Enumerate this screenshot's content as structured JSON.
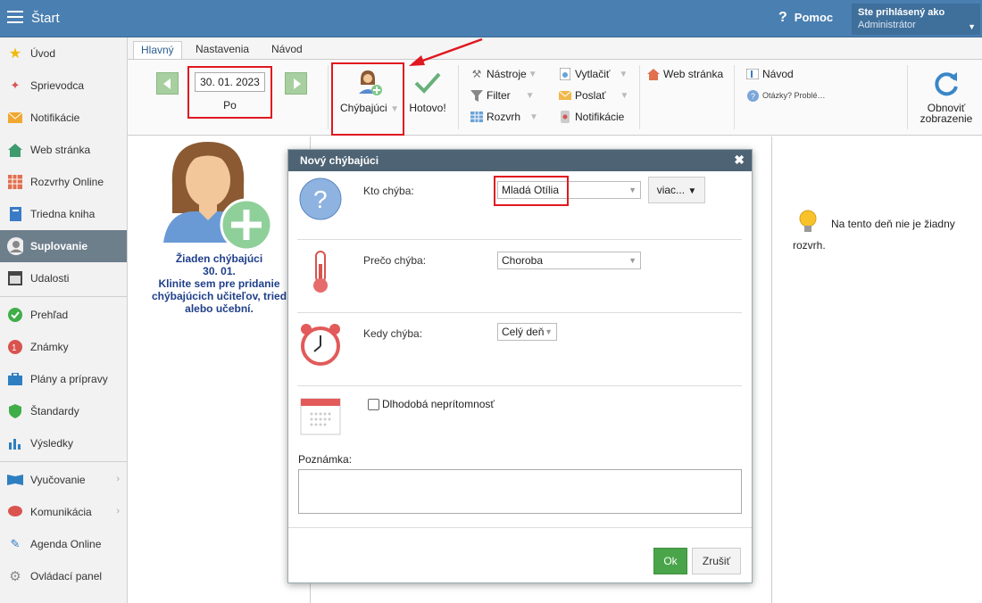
{
  "topbar": {
    "title": "Štart",
    "help_label": "Pomoc",
    "user_line1": "Ste prihlásený ako",
    "user_line2": "Administrátor"
  },
  "sidebar": {
    "items": [
      {
        "label": "Úvod",
        "icon": "star-icon"
      },
      {
        "label": "Sprievodca",
        "icon": "wand-icon"
      },
      {
        "label": "Notifikácie",
        "icon": "envelope-icon"
      },
      {
        "label": "Web stránka",
        "icon": "house-icon"
      },
      {
        "label": "Rozvrhy Online",
        "icon": "grid-icon"
      },
      {
        "label": "Triedna kniha",
        "icon": "book-icon"
      },
      {
        "label": "Suplovanie",
        "icon": "person-icon"
      },
      {
        "label": "Udalosti",
        "icon": "calendar-icon"
      },
      {
        "label": "Prehľad",
        "icon": "check-circle-icon"
      },
      {
        "label": "Známky",
        "icon": "grade-icon"
      },
      {
        "label": "Plány a prípravy",
        "icon": "briefcase-icon"
      },
      {
        "label": "Štandardy",
        "icon": "shield-icon"
      },
      {
        "label": "Výsledky",
        "icon": "bar-chart-icon"
      },
      {
        "label": "Vyučovanie",
        "icon": "open-book-icon"
      },
      {
        "label": "Komunikácia",
        "icon": "chat-icon"
      },
      {
        "label": "Agenda Online",
        "icon": "pen-icon"
      },
      {
        "label": "Ovládací panel",
        "icon": "gear-icon"
      }
    ]
  },
  "tabs": [
    "Hlavný",
    "Nastavenia",
    "Návod"
  ],
  "ribbon": {
    "date": "30. 01. 2023",
    "day": "Po",
    "missing_btn": "Chýbajúci",
    "done_btn": "Hotovo!",
    "tools": "Nástroje",
    "filter": "Filter",
    "schedule": "Rozvrh",
    "print": "Vytlačiť",
    "send": "Poslať",
    "notifications": "Notifikácie",
    "web": "Web stránka",
    "guide": "Návod",
    "questions": "Otázky? Problé…",
    "refresh_line1": "Obnoviť",
    "refresh_line2": "zobrazenie"
  },
  "left_panel": {
    "line1": "Žiaden chýbajúci",
    "line2": "30. 01.",
    "line3": "Klinite sem pre pridanie chýbajúcich učiteľov, tried alebo učební."
  },
  "right_panel": {
    "message_line1": "Na tento deň nie je žiadny",
    "message_line2": "rozvrh."
  },
  "dialog": {
    "title": "Nový chýbajúci",
    "who_label": "Kto chýba:",
    "who_value": "Mladá Otília",
    "more_btn": "viac...",
    "why_label": "Prečo chýba:",
    "why_value": "Choroba",
    "when_label": "Kedy chýba:",
    "when_value": "Celý deň",
    "long_term": "Dlhodobá neprítomnosť",
    "note_label": "Poznámka:",
    "ok": "Ok",
    "cancel": "Zrušiť"
  },
  "colors": {
    "topbar": "#4a7fb1",
    "highlight": "#e0181f",
    "ok_button": "#4aa54a"
  }
}
